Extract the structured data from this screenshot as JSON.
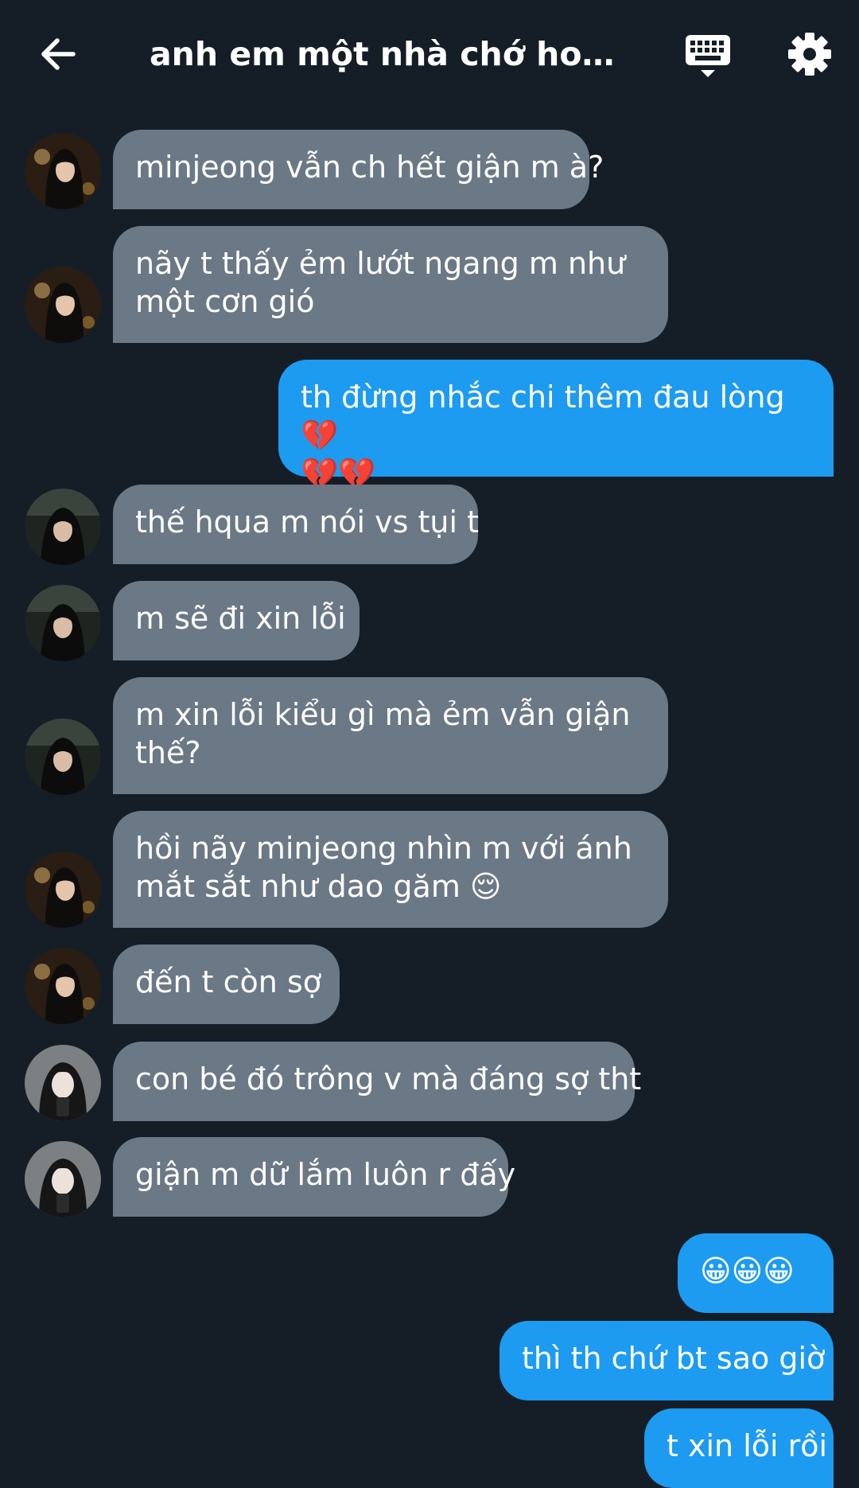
{
  "header": {
    "title": "anh em một nhà chớ hoài ...",
    "back_icon": "arrow-left-icon",
    "keyboard_icon": "keyboard-icon",
    "settings_icon": "gear-icon"
  },
  "colors": {
    "background": "#151e27",
    "incoming_bubble": "#6b7886",
    "outgoing_bubble": "#1d9bf0",
    "text": "#ffffff"
  },
  "messages": [
    {
      "direction": "in",
      "sender": "avatar-a",
      "text": "minjeong vẫn ch hết giận m à?"
    },
    {
      "direction": "in",
      "sender": "avatar-a",
      "text": "nãy t thấy ẻm lướt ngang m như\nmột cơn gió"
    },
    {
      "direction": "out",
      "text": "th đừng nhắc chi thêm đau lòng 💔\n💔💔"
    },
    {
      "direction": "in",
      "sender": "avatar-b",
      "text": "thế hqua m nói vs tụi t"
    },
    {
      "direction": "in",
      "sender": "avatar-b",
      "text": "m sẽ đi xin lỗi"
    },
    {
      "direction": "in",
      "sender": "avatar-b",
      "text": "m xin lỗi kiểu gì mà ẻm vẫn giận\nthế?"
    },
    {
      "direction": "in",
      "sender": "avatar-a",
      "text": "hồi nãy minjeong nhìn m với ánh\nmắt sắt như dao găm 😌"
    },
    {
      "direction": "in",
      "sender": "avatar-a",
      "text": "đến t còn sợ"
    },
    {
      "direction": "in",
      "sender": "avatar-c",
      "text": "con bé đó trông v mà đáng sợ tht"
    },
    {
      "direction": "in",
      "sender": "avatar-c",
      "text": "giận m dữ lắm luôn r đấy"
    },
    {
      "direction": "out",
      "text": "😀😀😀"
    },
    {
      "direction": "out",
      "text": "thì th chứ bt sao giờ"
    },
    {
      "direction": "out",
      "text": "t xin lỗi rồi"
    }
  ]
}
